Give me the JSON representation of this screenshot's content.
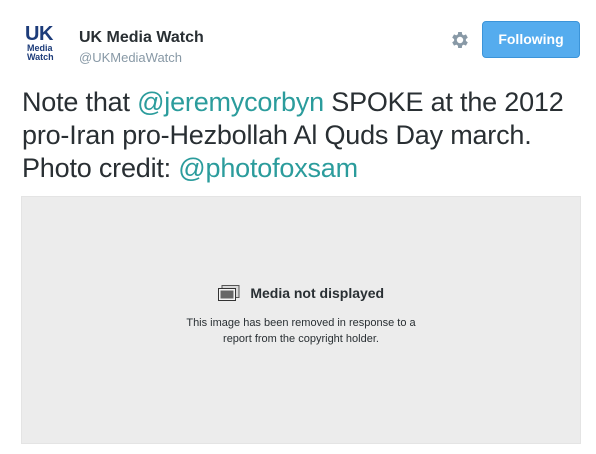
{
  "user": {
    "avatar_lines": [
      "UK",
      "Media",
      "Watch"
    ],
    "name": "UK Media Watch",
    "handle": "@UKMediaWatch"
  },
  "actions": {
    "settings_icon": "gear-icon",
    "follow_label": "Following"
  },
  "tweet": {
    "segments": [
      {
        "text": "Note that ",
        "type": "text"
      },
      {
        "text": "@jeremycorbyn",
        "type": "mention"
      },
      {
        "text": " SPOKE at the 2012 pro-Iran pro-Hezbollah Al Quds Day march. Photo credit: ",
        "type": "text"
      },
      {
        "text": "@photofoxsam",
        "type": "mention"
      }
    ]
  },
  "media": {
    "icon": "image-icon",
    "title": "Media not displayed",
    "description_lines": [
      "This image has been removed in response to a",
      "report from the copyright holder."
    ]
  },
  "colors": {
    "mention": "#2b9c9c",
    "follow_button": "#55acee",
    "handle": "#8899a6",
    "media_background": "#ececec"
  }
}
